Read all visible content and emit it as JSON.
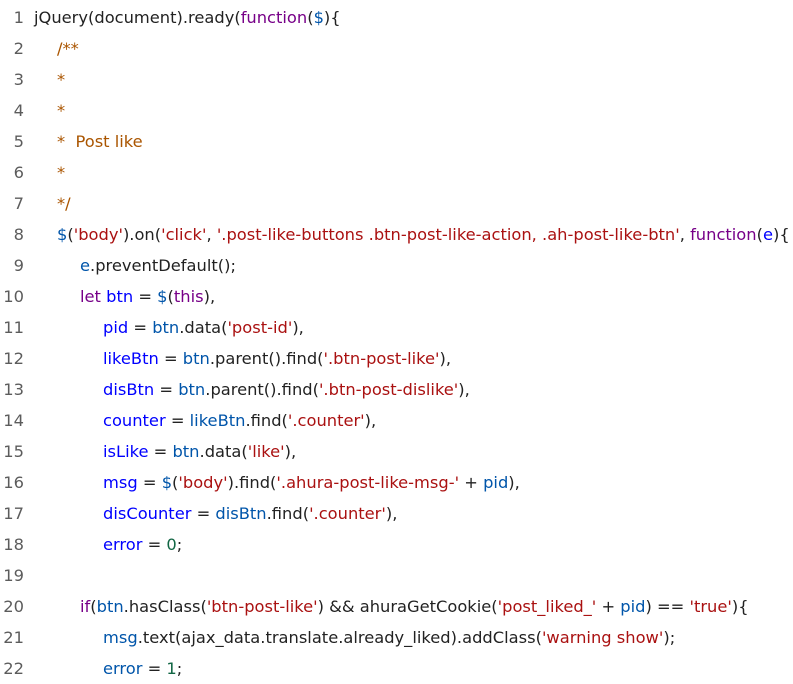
{
  "editor": {
    "lines": [
      {
        "num": "1",
        "indent": 0,
        "tokens": [
          {
            "t": "jQuery(document).ready(",
            "c": "plain"
          },
          {
            "t": "function",
            "c": "kw"
          },
          {
            "t": "(",
            "c": "plain"
          },
          {
            "t": "$",
            "c": "var"
          },
          {
            "t": "){",
            "c": "plain"
          }
        ]
      },
      {
        "num": "2",
        "indent": 1,
        "tokens": [
          {
            "t": "/**",
            "c": "comment"
          }
        ]
      },
      {
        "num": "3",
        "indent": 1,
        "tokens": [
          {
            "t": "*",
            "c": "comment"
          }
        ]
      },
      {
        "num": "4",
        "indent": 1,
        "tokens": [
          {
            "t": "*",
            "c": "comment"
          }
        ]
      },
      {
        "num": "5",
        "indent": 1,
        "tokens": [
          {
            "t": "*  Post like",
            "c": "comment"
          }
        ]
      },
      {
        "num": "6",
        "indent": 1,
        "tokens": [
          {
            "t": "*",
            "c": "comment"
          }
        ]
      },
      {
        "num": "7",
        "indent": 1,
        "tokens": [
          {
            "t": "*/",
            "c": "comment"
          }
        ]
      },
      {
        "num": "8",
        "indent": 1,
        "tokens": [
          {
            "t": "$",
            "c": "var"
          },
          {
            "t": "(",
            "c": "plain"
          },
          {
            "t": "'body'",
            "c": "str"
          },
          {
            "t": ").on(",
            "c": "plain"
          },
          {
            "t": "'click'",
            "c": "str"
          },
          {
            "t": ", ",
            "c": "plain"
          },
          {
            "t": "'.post-like-buttons .btn-post-like-action, .ah-post-like-btn'",
            "c": "str"
          },
          {
            "t": ", ",
            "c": "plain"
          },
          {
            "t": "function",
            "c": "kw"
          },
          {
            "t": "(",
            "c": "plain"
          },
          {
            "t": "e",
            "c": "def"
          },
          {
            "t": "){",
            "c": "plain"
          }
        ]
      },
      {
        "num": "9",
        "indent": 2,
        "tokens": [
          {
            "t": "e",
            "c": "var"
          },
          {
            "t": ".preventDefault();",
            "c": "plain"
          }
        ]
      },
      {
        "num": "10",
        "indent": 2,
        "tokens": [
          {
            "t": "let ",
            "c": "kw"
          },
          {
            "t": "btn",
            "c": "def"
          },
          {
            "t": " = ",
            "c": "plain"
          },
          {
            "t": "$",
            "c": "var"
          },
          {
            "t": "(",
            "c": "plain"
          },
          {
            "t": "this",
            "c": "kw"
          },
          {
            "t": "),",
            "c": "plain"
          }
        ]
      },
      {
        "num": "11",
        "indent": 3,
        "tokens": [
          {
            "t": "pid",
            "c": "def"
          },
          {
            "t": " = ",
            "c": "plain"
          },
          {
            "t": "btn",
            "c": "var"
          },
          {
            "t": ".data(",
            "c": "plain"
          },
          {
            "t": "'post-id'",
            "c": "str"
          },
          {
            "t": "),",
            "c": "plain"
          }
        ]
      },
      {
        "num": "12",
        "indent": 3,
        "tokens": [
          {
            "t": "likeBtn",
            "c": "def"
          },
          {
            "t": " = ",
            "c": "plain"
          },
          {
            "t": "btn",
            "c": "var"
          },
          {
            "t": ".parent().find(",
            "c": "plain"
          },
          {
            "t": "'.btn-post-like'",
            "c": "str"
          },
          {
            "t": "),",
            "c": "plain"
          }
        ]
      },
      {
        "num": "13",
        "indent": 3,
        "tokens": [
          {
            "t": "disBtn",
            "c": "def"
          },
          {
            "t": " = ",
            "c": "plain"
          },
          {
            "t": "btn",
            "c": "var"
          },
          {
            "t": ".parent().find(",
            "c": "plain"
          },
          {
            "t": "'.btn-post-dislike'",
            "c": "str"
          },
          {
            "t": "),",
            "c": "plain"
          }
        ]
      },
      {
        "num": "14",
        "indent": 3,
        "tokens": [
          {
            "t": "counter",
            "c": "def"
          },
          {
            "t": " = ",
            "c": "plain"
          },
          {
            "t": "likeBtn",
            "c": "var"
          },
          {
            "t": ".find(",
            "c": "plain"
          },
          {
            "t": "'.counter'",
            "c": "str"
          },
          {
            "t": "),",
            "c": "plain"
          }
        ]
      },
      {
        "num": "15",
        "indent": 3,
        "tokens": [
          {
            "t": "isLike",
            "c": "def"
          },
          {
            "t": " = ",
            "c": "plain"
          },
          {
            "t": "btn",
            "c": "var"
          },
          {
            "t": ".data(",
            "c": "plain"
          },
          {
            "t": "'like'",
            "c": "str"
          },
          {
            "t": "),",
            "c": "plain"
          }
        ]
      },
      {
        "num": "16",
        "indent": 3,
        "tokens": [
          {
            "t": "msg",
            "c": "def"
          },
          {
            "t": " = ",
            "c": "plain"
          },
          {
            "t": "$",
            "c": "var"
          },
          {
            "t": "(",
            "c": "plain"
          },
          {
            "t": "'body'",
            "c": "str"
          },
          {
            "t": ").find(",
            "c": "plain"
          },
          {
            "t": "'.ahura-post-like-msg-'",
            "c": "str"
          },
          {
            "t": " + ",
            "c": "plain"
          },
          {
            "t": "pid",
            "c": "var"
          },
          {
            "t": "),",
            "c": "plain"
          }
        ]
      },
      {
        "num": "17",
        "indent": 3,
        "tokens": [
          {
            "t": "disCounter",
            "c": "def"
          },
          {
            "t": " = ",
            "c": "plain"
          },
          {
            "t": "disBtn",
            "c": "var"
          },
          {
            "t": ".find(",
            "c": "plain"
          },
          {
            "t": "'.counter'",
            "c": "str"
          },
          {
            "t": "),",
            "c": "plain"
          }
        ]
      },
      {
        "num": "18",
        "indent": 3,
        "tokens": [
          {
            "t": "error",
            "c": "def"
          },
          {
            "t": " = ",
            "c": "plain"
          },
          {
            "t": "0",
            "c": "num"
          },
          {
            "t": ";",
            "c": "plain"
          }
        ]
      },
      {
        "num": "19",
        "indent": 0,
        "tokens": []
      },
      {
        "num": "20",
        "indent": 2,
        "tokens": [
          {
            "t": "if",
            "c": "kw"
          },
          {
            "t": "(",
            "c": "plain"
          },
          {
            "t": "btn",
            "c": "var"
          },
          {
            "t": ".hasClass(",
            "c": "plain"
          },
          {
            "t": "'btn-post-like'",
            "c": "str"
          },
          {
            "t": ") && ahuraGetCookie(",
            "c": "plain"
          },
          {
            "t": "'post_liked_'",
            "c": "str"
          },
          {
            "t": " + ",
            "c": "plain"
          },
          {
            "t": "pid",
            "c": "var"
          },
          {
            "t": ") == ",
            "c": "plain"
          },
          {
            "t": "'true'",
            "c": "str"
          },
          {
            "t": "){",
            "c": "plain"
          }
        ]
      },
      {
        "num": "21",
        "indent": 3,
        "tokens": [
          {
            "t": "msg",
            "c": "var"
          },
          {
            "t": ".text(ajax_data.translate.already_liked).addClass(",
            "c": "plain"
          },
          {
            "t": "'warning show'",
            "c": "str"
          },
          {
            "t": ");",
            "c": "plain"
          }
        ]
      },
      {
        "num": "22",
        "indent": 3,
        "tokens": [
          {
            "t": "error",
            "c": "var"
          },
          {
            "t": " = ",
            "c": "plain"
          },
          {
            "t": "1",
            "c": "num"
          },
          {
            "t": ";",
            "c": "plain"
          }
        ]
      }
    ]
  }
}
